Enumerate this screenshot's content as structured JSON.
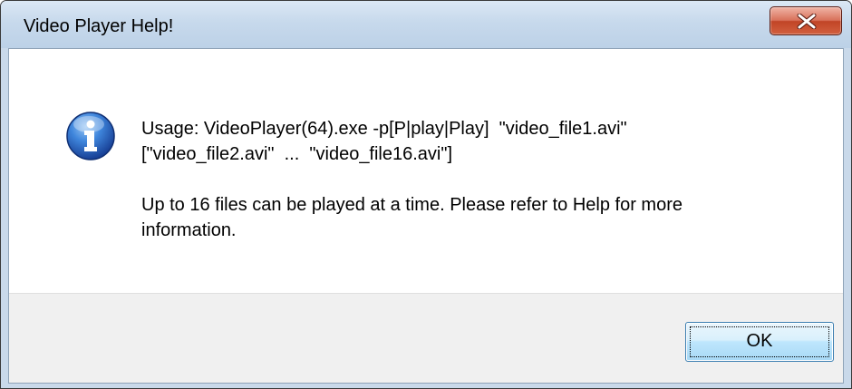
{
  "window": {
    "title": "Video Player Help!"
  },
  "title_buttons": {
    "close_icon": "close-x-icon"
  },
  "message": {
    "icon": "information-icon",
    "usage_line_1": "Usage: VideoPlayer(64).exe -p[P|play|Play]  \"video_file1.avi\"",
    "usage_line_2": "[\"video_file2.avi\"  ...  \"video_file16.avi\"]",
    "info_line_1": "Up to 16 files can be played at a time. Please refer to Help for more",
    "info_line_2": "information."
  },
  "buttons": {
    "ok_label": "OK"
  },
  "colors": {
    "close_button": "#c7502f",
    "info_icon": "#1f5fb8",
    "ok_button": "#bee6fd"
  }
}
